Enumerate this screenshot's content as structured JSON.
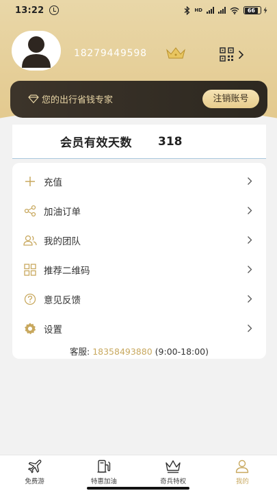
{
  "status_bar": {
    "time": "13:22",
    "network_label": "HD",
    "battery": "66"
  },
  "profile": {
    "phone": "18279449598",
    "crown_icon": "crown-icon",
    "qr_icon": "qr-code-icon"
  },
  "member_card": {
    "slogan": "您的出行省钱专家",
    "cancel_button": "注销账号"
  },
  "valid_days": {
    "label": "会员有效天数",
    "value": "318"
  },
  "menu": [
    {
      "label": "充值",
      "icon": "plus-icon"
    },
    {
      "label": "加油订单",
      "icon": "share-icon"
    },
    {
      "label": "我的团队",
      "icon": "team-icon"
    },
    {
      "label": "推荐二维码",
      "icon": "grid-icon"
    },
    {
      "label": "意见反馈",
      "icon": "question-icon"
    },
    {
      "label": "设置",
      "icon": "gear-icon"
    }
  ],
  "service": {
    "label": "客服:",
    "phone": "18358493880",
    "hours": "(9:00-18:00)"
  },
  "bottom_nav": [
    {
      "label": "免费游",
      "icon": "airplane-icon"
    },
    {
      "label": "特惠加油",
      "icon": "fuel-icon"
    },
    {
      "label": "奇兵特权",
      "icon": "crown-icon"
    },
    {
      "label": "我的",
      "icon": "person-icon",
      "active": true
    }
  ],
  "colors": {
    "gold": "#e3c98e",
    "accent": "#c8a85e",
    "dark_card": "#342e25"
  }
}
